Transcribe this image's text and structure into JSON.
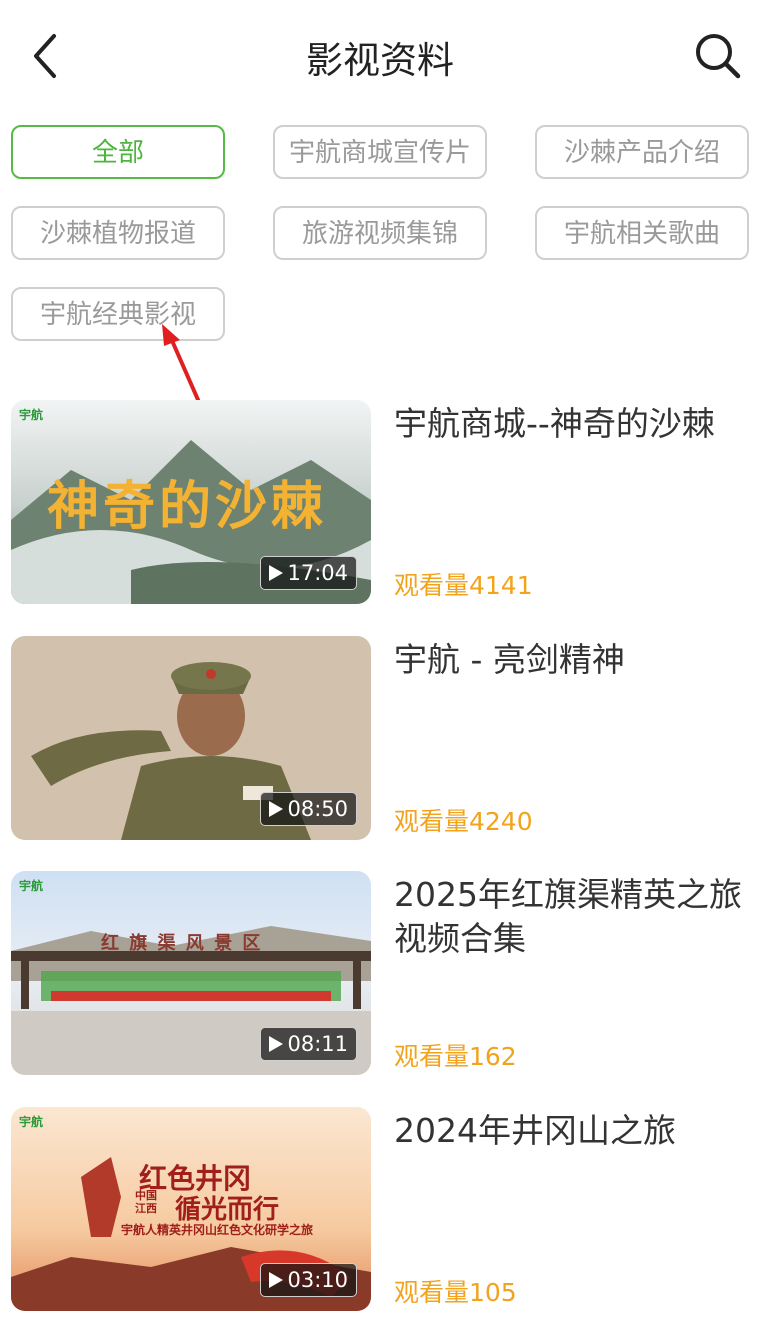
{
  "header": {
    "title": "影视资料",
    "back_icon": "chevron-left-icon",
    "search_icon": "search-icon"
  },
  "filters": [
    {
      "label": "全部",
      "active": true
    },
    {
      "label": "宇航商城宣传片",
      "active": false
    },
    {
      "label": "沙棘产品介绍",
      "active": false
    },
    {
      "label": "沙棘植物报道",
      "active": false
    },
    {
      "label": "旅游视频集锦",
      "active": false
    },
    {
      "label": "宇航相关歌曲",
      "active": false
    },
    {
      "label": "宇航经典影视",
      "active": false
    }
  ],
  "videos": [
    {
      "title": "宇航商城--神奇的沙棘",
      "duration": "17:04",
      "views": "观看量4141",
      "thumb_text": "神奇的沙棘",
      "logo": "宇航"
    },
    {
      "title": "宇航 - 亮剑精神",
      "duration": "08:50",
      "views": "观看量4240"
    },
    {
      "title": "2025年红旗渠精英之旅视频合集",
      "duration": "08:11",
      "views": "观看量162",
      "thumb_text": "红 旗 渠 风 景 区",
      "logo": "宇航"
    },
    {
      "title": "2024年井冈山之旅",
      "duration": "03:10",
      "views": "观看量105",
      "thumb_text": "红色井冈",
      "thumb_text_2": "循光而行",
      "thumb_text_3": "宇航人精英井冈山红色文化研学之旅",
      "thumb_text_4": "中国 江西",
      "logo": "宇航"
    }
  ],
  "colors": {
    "accent_green": "#4cb63c",
    "views_orange": "#f2a31b",
    "annotation_red": "#e02020"
  }
}
